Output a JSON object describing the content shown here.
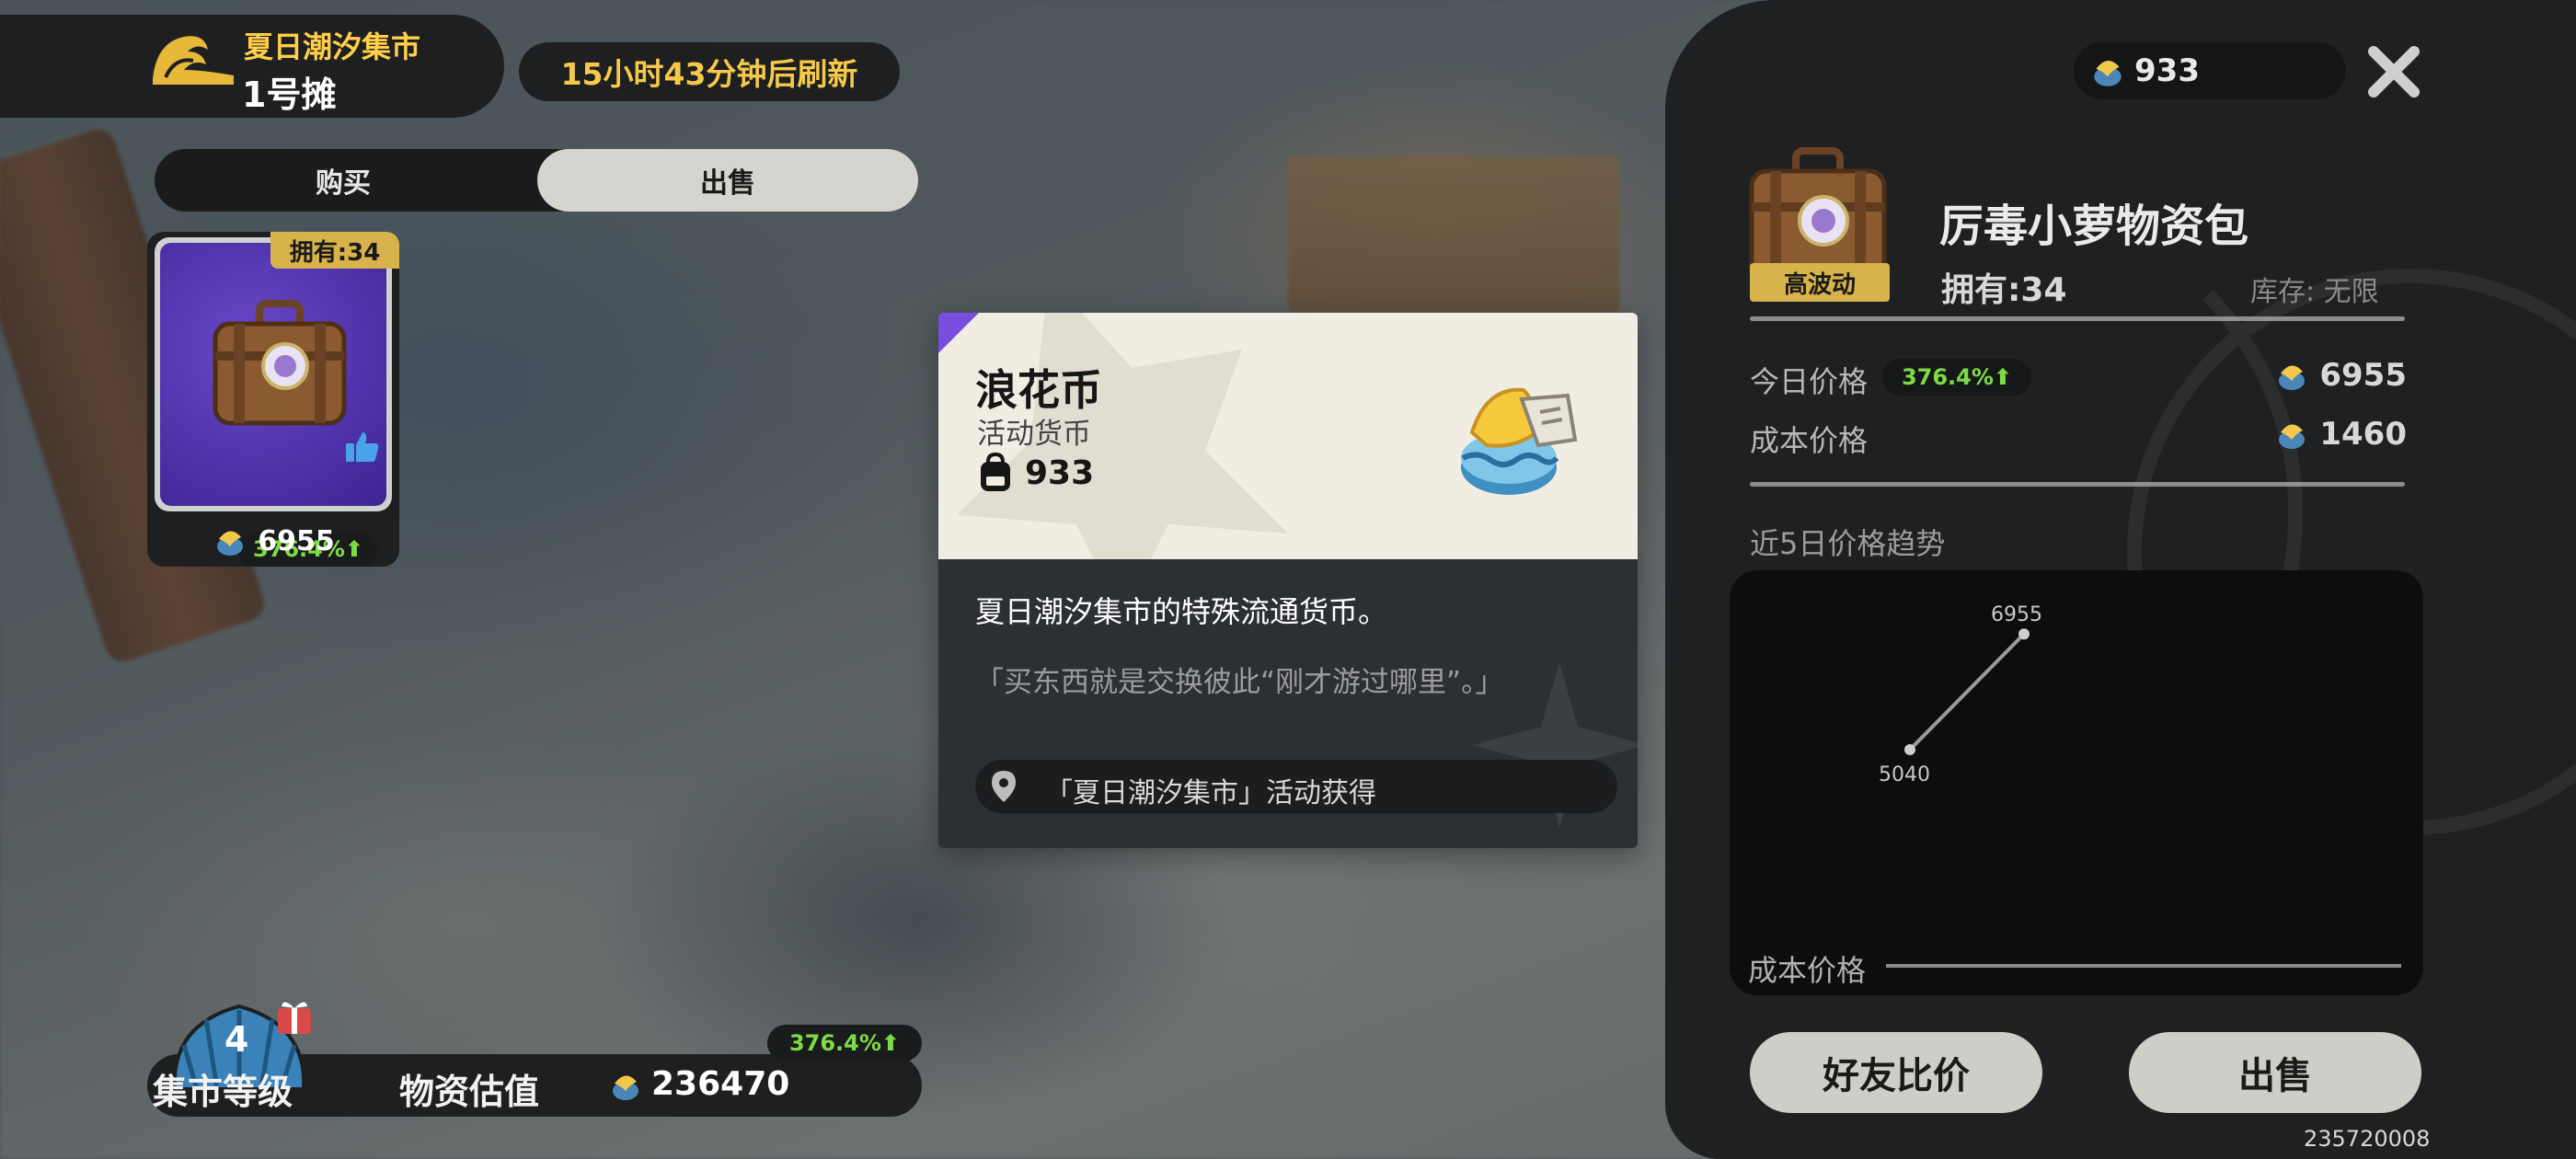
{
  "stall": {
    "market_name": "夏日潮汐集市",
    "stall_number": "1号摊",
    "refresh_timer": "15小时43分钟后刷新"
  },
  "tabs": {
    "buy": "购买",
    "sell": "出售",
    "active": "sell"
  },
  "item_card": {
    "owned": "拥有:34",
    "change": "376.4%",
    "price": "6955"
  },
  "market_bar": {
    "level": "4",
    "level_label": "集市等级",
    "estimate_label": "物资估值",
    "estimate_value": "236470",
    "change": "376.4%"
  },
  "tooltip": {
    "title": "浪花币",
    "subtitle": "活动货币",
    "count": "933",
    "description": "夏日潮汐集市的特殊流通货币。",
    "quote": "「买东西就是交换彼此“刚才游过哪里”。」",
    "source": "「夏日潮汐集市」活动获得"
  },
  "panel": {
    "coin_balance": "933",
    "item_name": "厉毒小萝物资包",
    "volatility": "高波动",
    "owned": "拥有:34",
    "stock": "库存: 无限",
    "today_price_label": "今日价格",
    "today_change": "376.4%",
    "today_price": "6955",
    "cost_price_label": "成本价格",
    "cost_price": "1460",
    "trend_label": "近5日价格趋势",
    "cost_line_label": "成本价格",
    "compare_button": "好友比价",
    "sell_button": "出售",
    "uid": "235720008"
  },
  "colors": {
    "accent_gold": "#d8b24a",
    "positive_green": "#7ddc45",
    "panel_dark": "#1f2021",
    "tooltip_purple": "#7a4ce0"
  },
  "chart_data": {
    "type": "line",
    "x": [
      1,
      2
    ],
    "values": [
      5040,
      6955
    ],
    "data_labels": [
      "5040",
      "6955"
    ],
    "cost_line": 1460,
    "ylim": [
      1460,
      7400
    ]
  }
}
